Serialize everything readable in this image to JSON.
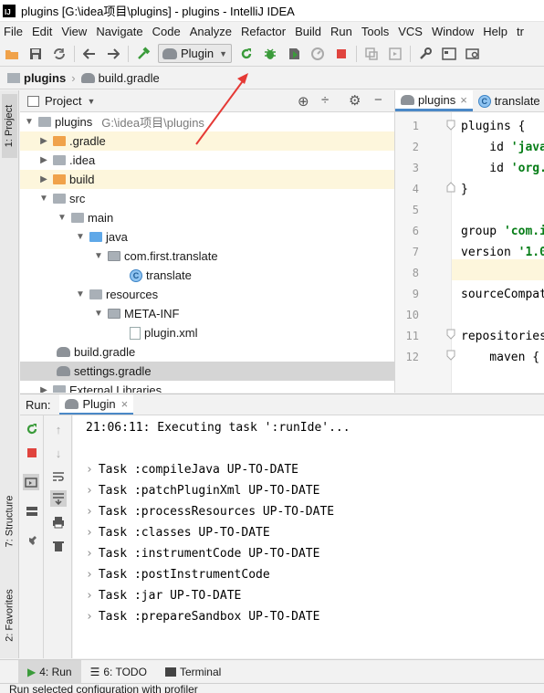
{
  "window": {
    "title": "plugins [G:\\idea项目\\plugins] - plugins - IntelliJ IDEA",
    "logo_text": "IJ"
  },
  "menu": [
    "File",
    "Edit",
    "View",
    "Navigate",
    "Code",
    "Analyze",
    "Refactor",
    "Build",
    "Run",
    "Tools",
    "VCS",
    "Window",
    "Help",
    "tr"
  ],
  "toolbar": {
    "run_config": "Plugin",
    "icons": [
      "save-all-icon",
      "sync-icon",
      "back-icon",
      "forward-icon",
      "build-hammer-icon",
      "rerun-icon",
      "debug-bug-icon",
      "coverage-icon",
      "profile-icon",
      "stop-icon",
      "frames-icon",
      "structure-icon",
      "settings-wrench-icon",
      "project-structure-icon",
      "find-icon"
    ]
  },
  "breadcrumb": {
    "root": "plugins",
    "file": "build.gradle"
  },
  "left_strip": {
    "project_tab": "1: Project",
    "structure_tab": "7: Structure",
    "favorites_tab": "2: Favorites"
  },
  "project_panel": {
    "title": "Project",
    "tree": [
      {
        "label": "plugins",
        "hint": "G:\\idea项目\\plugins"
      },
      {
        "label": ".gradle"
      },
      {
        "label": ".idea"
      },
      {
        "label": "build"
      },
      {
        "label": "src"
      },
      {
        "label": "main"
      },
      {
        "label": "java"
      },
      {
        "label": "com.first.translate"
      },
      {
        "label": "translate"
      },
      {
        "label": "resources"
      },
      {
        "label": "META-INF"
      },
      {
        "label": "plugin.xml"
      },
      {
        "label": "build.gradle"
      },
      {
        "label": "settings.gradle"
      },
      {
        "label": "External Libraries"
      }
    ]
  },
  "editor": {
    "tabs": [
      {
        "label": "plugins",
        "close": "×"
      },
      {
        "label": "translate"
      }
    ],
    "line_numbers": [
      "1",
      "2",
      "3",
      "4",
      "5",
      "6",
      "7",
      "8",
      "9",
      "10",
      "11",
      "12"
    ],
    "lines": {
      "l1": "plugins {",
      "l2_pre": "    id ",
      "l2_str": "'java",
      "l3_pre": "    id ",
      "l3_str": "'org.",
      "l4": "}",
      "l6_pre": "group ",
      "l6_str": "'com.i",
      "l7_pre": "version ",
      "l7_str": "'1.0",
      "l9": "sourceCompat",
      "l11": "repositories",
      "l12": "    maven {"
    }
  },
  "run_panel": {
    "label": "Run:",
    "tab": "Plugin",
    "tab_close": "×",
    "header_line": "21:06:11: Executing task ':runIde'...",
    "tasks": [
      "Task :compileJava UP-TO-DATE",
      "Task :patchPluginXml UP-TO-DATE",
      "Task :processResources UP-TO-DATE",
      "Task :classes UP-TO-DATE",
      "Task :instrumentCode UP-TO-DATE",
      "Task :postInstrumentCode",
      "Task :jar UP-TO-DATE",
      "Task :prepareSandbox UP-TO-DATE"
    ]
  },
  "bottom_tabs": {
    "run": "4: Run",
    "todo": "6: TODO",
    "terminal": "Terminal"
  },
  "status": "Run selected configuration with profiler",
  "colors": {
    "accent": "#4a88c7",
    "annotation_arrow": "#e53935",
    "rerun_green": "#3a9b3a",
    "stop_red": "#e0443e"
  }
}
